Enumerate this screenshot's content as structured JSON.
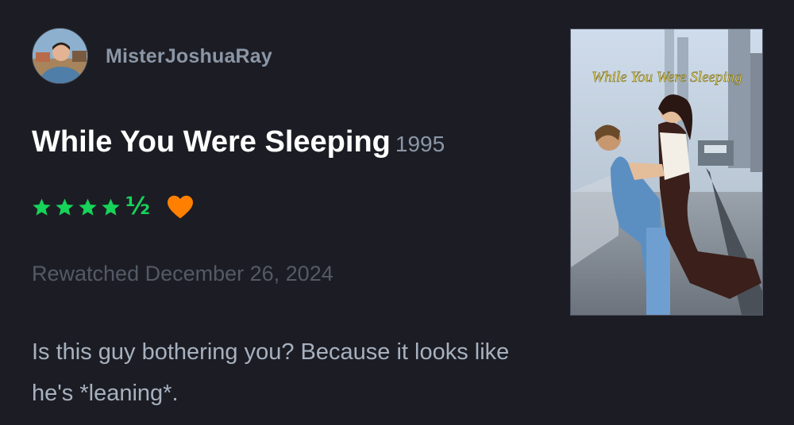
{
  "user": {
    "name": "MisterJoshuaRay"
  },
  "film": {
    "title": "While You Were Sleeping",
    "year": "1995",
    "poster_title": "While You Were Sleeping"
  },
  "rating": {
    "stars": 4.5,
    "half_symbol": "½",
    "liked": true
  },
  "watch": {
    "date_text": "Rewatched December 26, 2024"
  },
  "review": {
    "text": "Is this guy bothering you? Because it looks like he's *leaning*."
  },
  "colors": {
    "background": "#1c1d24",
    "star": "#16d35a",
    "heart": "#ff8000",
    "title": "#ffffff",
    "muted": "#8b96a6"
  }
}
